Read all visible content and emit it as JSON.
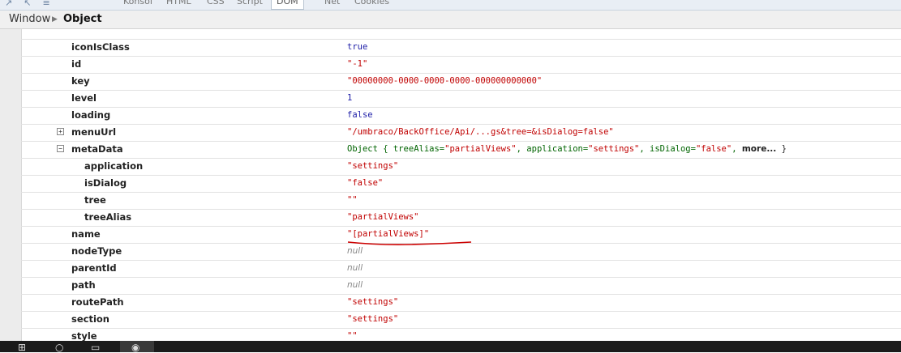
{
  "tabs": {
    "labels": [
      "Konsol",
      "HTML",
      "CSS",
      "Script",
      "DOM",
      "Net",
      "Cookies"
    ],
    "active": "DOM"
  },
  "breadcrumb": {
    "root": "Window",
    "current": "Object"
  },
  "rows": [
    {
      "key": "iconIsClass",
      "value": "true",
      "type": "bool"
    },
    {
      "key": "id",
      "value": "\"-1\"",
      "type": "string"
    },
    {
      "key": "key",
      "value": "\"00000000-0000-0000-0000-000000000000\"",
      "type": "string"
    },
    {
      "key": "level",
      "value": "1",
      "type": "num"
    },
    {
      "key": "loading",
      "value": "false",
      "type": "bool"
    },
    {
      "key": "menuUrl",
      "value": "\"/umbraco/BackOffice/Api/...gs&tree=&isDialog=false\"",
      "type": "string",
      "toggle": "+"
    },
    {
      "key": "metaData",
      "type": "object",
      "toggle": "−"
    },
    {
      "key": "application",
      "value": "\"settings\"",
      "type": "string",
      "child": true
    },
    {
      "key": "isDialog",
      "value": "\"false\"",
      "type": "string",
      "child": true
    },
    {
      "key": "tree",
      "value": "\"\"",
      "type": "string",
      "child": true
    },
    {
      "key": "treeAlias",
      "value": "\"partialViews\"",
      "type": "string",
      "child": true
    },
    {
      "key": "name",
      "value": "\"[partialViews]\"",
      "type": "string"
    },
    {
      "key": "nodeType",
      "value": "null",
      "type": "null"
    },
    {
      "key": "parentId",
      "value": "null",
      "type": "null"
    },
    {
      "key": "path",
      "value": "null",
      "type": "null"
    },
    {
      "key": "routePath",
      "value": "\"settings\"",
      "type": "string"
    },
    {
      "key": "section",
      "value": "\"settings\"",
      "type": "string"
    },
    {
      "key": "style",
      "value": "\"\"",
      "type": "string"
    }
  ],
  "metaData_summary": {
    "prefix": "Object {",
    "pairs": [
      {
        "k": "treeAlias=",
        "v": "\"partialViews\""
      },
      {
        "k": "application=",
        "v": "\"settings\""
      },
      {
        "k": "isDialog=",
        "v": "\"false\""
      }
    ],
    "more": "more...",
    "suffix": "}"
  },
  "colors": {
    "string": "#c00000",
    "bool_num": "#1a1aa6",
    "object": "#006400",
    "annotation": "#cc0000"
  }
}
